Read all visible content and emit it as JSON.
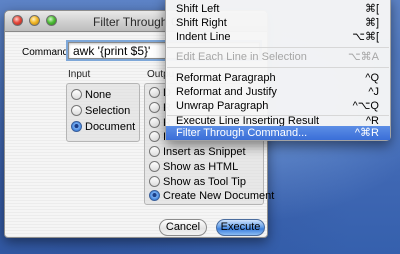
{
  "dialog": {
    "title": "Filter Through Co",
    "command_label": "Command:",
    "command_value": "awk '{print $5}'",
    "input": {
      "title": "Input",
      "options": [
        {
          "label": "None",
          "selected": false
        },
        {
          "label": "Selection",
          "selected": false
        },
        {
          "label": "Document",
          "selected": true
        }
      ]
    },
    "output": {
      "title": "Outpu",
      "options": [
        {
          "label": "D",
          "selected": false
        },
        {
          "label": "R",
          "selected": false
        },
        {
          "label": "R",
          "selected": false
        },
        {
          "label": "I",
          "selected": false
        },
        {
          "label": "Insert as Snippet",
          "selected": false
        },
        {
          "label": "Show as HTML",
          "selected": false
        },
        {
          "label": "Show as Tool Tip",
          "selected": false
        },
        {
          "label": "Create New Document",
          "selected": true
        }
      ]
    },
    "cancel_label": "Cancel",
    "execute_label": "Execute"
  },
  "menu": {
    "items": [
      {
        "label": "Shift Left",
        "shortcut": "⌘[",
        "state": "normal"
      },
      {
        "label": "Shift Right",
        "shortcut": "⌘]",
        "state": "normal"
      },
      {
        "label": "Indent Line",
        "shortcut": "⌥⌘[",
        "state": "normal"
      },
      {
        "label": "Edit Each Line in Selection",
        "shortcut": "⌥⌘A",
        "state": "disabled"
      },
      {
        "label": "Reformat Paragraph",
        "shortcut": "^Q",
        "state": "normal"
      },
      {
        "label": "Reformat and Justify",
        "shortcut": "^J",
        "state": "normal"
      },
      {
        "label": "Unwrap Paragraph",
        "shortcut": "^⌥Q",
        "state": "normal"
      },
      {
        "label": "Execute Line Inserting Result",
        "shortcut": "^R",
        "state": "normal"
      },
      {
        "label": "Filter Through Command...",
        "shortcut": "^⌘R",
        "state": "selected"
      }
    ]
  },
  "colors": {
    "menu_highlight": "#3a6ed8",
    "execute_button": "#3c7fdc",
    "desktop": "#4a73bc"
  }
}
